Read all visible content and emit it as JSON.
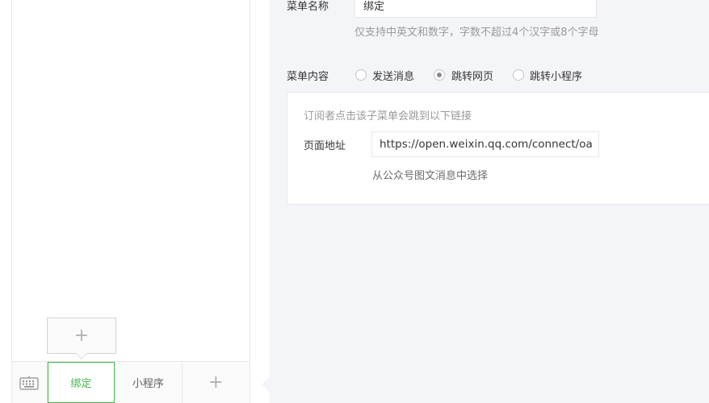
{
  "preview": {
    "sub_menu_add_symbol": "+",
    "menu_items": [
      {
        "label": "绑定",
        "active": true
      },
      {
        "label": "小程序",
        "active": false
      }
    ],
    "add_symbol": "+",
    "accent_color": "#44b549"
  },
  "editor": {
    "name_label": "菜单名称",
    "name_value": "绑定",
    "name_hint": "仅支持中英文和数字，字数不超过4个汉字或8个字母",
    "content_label": "菜单内容",
    "content_options": [
      {
        "label": "发送消息",
        "checked": false
      },
      {
        "label": "跳转网页",
        "checked": true
      },
      {
        "label": "跳转小程序",
        "checked": false
      }
    ],
    "link_desc": "订阅者点击该子菜单会跳到以下链接",
    "page_url_label": "页面地址",
    "page_url_value": "https://open.weixin.qq.com/connect/oa",
    "choose_from_article": "从公众号图文消息中选择"
  }
}
